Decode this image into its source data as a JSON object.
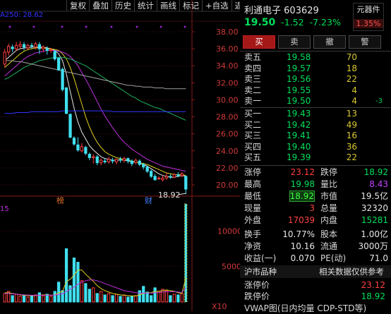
{
  "toolbar": [
    "复权",
    "叠加",
    "历史",
    "统计",
    "画线",
    "标记",
    "+自选",
    "返回"
  ],
  "ma_legend": "A250: 28.62",
  "price_axis": [
    "38.00",
    "36.00",
    "34.00",
    "32.00",
    "30.00",
    "28.00",
    "26.00",
    "24.00",
    "22.00",
    "20.00"
  ],
  "volume_axis": [
    "10000",
    "5000",
    "X10"
  ],
  "chart_marks": {
    "bang": "榜",
    "cai": "财",
    "low_label": "18.92",
    "vol_prefix": "15"
  },
  "stock": {
    "name": "利通电子",
    "code": "603629",
    "price": "19.50",
    "change": "-1.52",
    "change_pct": "-7.23%"
  },
  "component": {
    "label": "元器件",
    "pct": "1.35%"
  },
  "buttons": {
    "buy": "买",
    "sell": "卖",
    "cancel": "撤",
    "alert": "警"
  },
  "asks": [
    {
      "label": "卖五",
      "price": "19.58",
      "vol": "70",
      "ext": ""
    },
    {
      "label": "卖四",
      "price": "19.57",
      "vol": "18",
      "ext": ""
    },
    {
      "label": "卖三",
      "price": "19.56",
      "vol": "22",
      "ext": ""
    },
    {
      "label": "卖二",
      "price": "19.55",
      "vol": "4",
      "ext": ""
    },
    {
      "label": "卖一",
      "price": "19.50",
      "vol": "4",
      "ext": "-3"
    }
  ],
  "bids": [
    {
      "label": "买一",
      "price": "19.43",
      "vol": "13"
    },
    {
      "label": "买二",
      "price": "19.42",
      "vol": "49"
    },
    {
      "label": "买三",
      "price": "19.41",
      "vol": "16"
    },
    {
      "label": "买四",
      "price": "19.40",
      "vol": "36"
    },
    {
      "label": "买五",
      "price": "19.39",
      "vol": "22"
    }
  ],
  "stats": [
    {
      "l1": "涨停",
      "v1": "23.12",
      "l2": "跌停",
      "v2": "18.92"
    },
    {
      "l1": "最高",
      "v1": "19.98",
      "l2": "量比",
      "v2": "8.43"
    },
    {
      "l1": "最低",
      "v1": "18.92",
      "l2": "市值",
      "v2": "19.5亿"
    },
    {
      "l1": "现量",
      "v1": "3",
      "l2": "总量",
      "v2": "32320"
    },
    {
      "l1": "外盘",
      "v1": "17039",
      "l2": "内盘",
      "v2": "15281"
    },
    {
      "l1": "换手",
      "v1": "10.77%",
      "l2": "股本",
      "v2": "1.00亿"
    },
    {
      "l1": "净资",
      "v1": "10.16",
      "l2": "流通",
      "v2": "3000万"
    },
    {
      "l1": "收益(一)",
      "v1": "0.070",
      "l2": "PE(动)",
      "v2": "71.0"
    }
  ],
  "exchange": {
    "left": "沪市品种",
    "right": "相关数据仅供参考"
  },
  "limits": [
    {
      "label": "涨停价",
      "value": "23.12"
    },
    {
      "label": "跌停价",
      "value": "18.92"
    }
  ],
  "vwap": "VWAP图(日内均量 CDP-STD等)",
  "colors": {
    "up": "#ff4040",
    "down": "#00e05a",
    "cyan": "#40e0f0"
  },
  "chart_data": {
    "type": "candlestick",
    "ylim": [
      19.0,
      38.6
    ],
    "candles": [
      {
        "o": 34.2,
        "c": 35.6,
        "h": 36.0,
        "l": 33.8
      },
      {
        "o": 35.6,
        "c": 36.3,
        "h": 36.6,
        "l": 35.2
      },
      {
        "o": 36.2,
        "c": 36.0,
        "h": 36.5,
        "l": 35.6
      },
      {
        "o": 36.0,
        "c": 36.4,
        "h": 36.8,
        "l": 35.7
      },
      {
        "o": 36.3,
        "c": 36.5,
        "h": 36.9,
        "l": 36.0
      },
      {
        "o": 36.5,
        "c": 36.2,
        "h": 36.8,
        "l": 35.8
      },
      {
        "o": 36.1,
        "c": 36.4,
        "h": 36.6,
        "l": 35.9
      },
      {
        "o": 36.4,
        "c": 36.3,
        "h": 36.7,
        "l": 36.0
      },
      {
        "o": 36.2,
        "c": 36.6,
        "h": 36.8,
        "l": 35.9
      },
      {
        "o": 36.5,
        "c": 36.0,
        "h": 36.8,
        "l": 35.4
      },
      {
        "o": 36.0,
        "c": 36.2,
        "h": 36.4,
        "l": 35.6
      },
      {
        "o": 36.0,
        "c": 35.8,
        "h": 36.3,
        "l": 35.3
      },
      {
        "o": 35.8,
        "c": 35.9,
        "h": 36.1,
        "l": 35.5
      },
      {
        "o": 35.7,
        "c": 34.8,
        "h": 35.9,
        "l": 34.6
      },
      {
        "o": 34.9,
        "c": 33.5,
        "h": 35.0,
        "l": 33.4
      },
      {
        "o": 33.6,
        "c": 31.2,
        "h": 33.8,
        "l": 31.0
      },
      {
        "o": 31.4,
        "c": 28.4,
        "h": 31.5,
        "l": 28.3
      },
      {
        "o": 28.3,
        "c": 25.6,
        "h": 28.4,
        "l": 25.5
      },
      {
        "o": 25.5,
        "c": 24.8,
        "h": 25.7,
        "l": 24.6
      },
      {
        "o": 24.7,
        "c": 24.1,
        "h": 25.6,
        "l": 23.9
      },
      {
        "o": 24.0,
        "c": 24.5,
        "h": 24.9,
        "l": 23.8
      },
      {
        "o": 24.4,
        "c": 23.7,
        "h": 24.6,
        "l": 23.5
      },
      {
        "o": 23.6,
        "c": 23.2,
        "h": 23.8,
        "l": 22.9
      },
      {
        "o": 23.2,
        "c": 23.3,
        "h": 23.6,
        "l": 22.5
      },
      {
        "o": 23.3,
        "c": 22.6,
        "h": 23.5,
        "l": 22.3
      },
      {
        "o": 22.6,
        "c": 22.9,
        "h": 23.1,
        "l": 22.3
      },
      {
        "o": 22.8,
        "c": 22.7,
        "h": 23.1,
        "l": 22.5
      },
      {
        "o": 22.7,
        "c": 23.0,
        "h": 23.3,
        "l": 22.5
      },
      {
        "o": 22.9,
        "c": 22.8,
        "h": 23.2,
        "l": 22.5
      },
      {
        "o": 22.7,
        "c": 23.0,
        "h": 23.1,
        "l": 22.4
      },
      {
        "o": 23.0,
        "c": 22.9,
        "h": 23.3,
        "l": 22.6
      },
      {
        "o": 22.9,
        "c": 23.1,
        "h": 23.3,
        "l": 22.6
      },
      {
        "o": 23.1,
        "c": 22.8,
        "h": 23.2,
        "l": 22.5
      },
      {
        "o": 22.8,
        "c": 22.5,
        "h": 23.0,
        "l": 22.2
      },
      {
        "o": 22.6,
        "c": 22.9,
        "h": 23.1,
        "l": 22.4
      },
      {
        "o": 22.8,
        "c": 22.4,
        "h": 23.0,
        "l": 22.2
      },
      {
        "o": 22.4,
        "c": 22.1,
        "h": 22.6,
        "l": 21.8
      },
      {
        "o": 22.1,
        "c": 21.6,
        "h": 22.3,
        "l": 21.4
      },
      {
        "o": 21.6,
        "c": 21.0,
        "h": 21.8,
        "l": 20.8
      },
      {
        "o": 21.0,
        "c": 20.6,
        "h": 21.3,
        "l": 20.5
      },
      {
        "o": 20.7,
        "c": 20.8,
        "h": 21.0,
        "l": 20.6
      },
      {
        "o": 20.6,
        "c": 20.8,
        "h": 21.1,
        "l": 20.4
      },
      {
        "o": 20.8,
        "c": 21.0,
        "h": 21.4,
        "l": 20.6
      },
      {
        "o": 21.0,
        "c": 20.9,
        "h": 21.3,
        "l": 20.7
      },
      {
        "o": 20.9,
        "c": 21.2,
        "h": 21.4,
        "l": 20.8
      },
      {
        "o": 21.2,
        "c": 21.1,
        "h": 21.5,
        "l": 20.9
      },
      {
        "o": 21.1,
        "c": 21.3,
        "h": 21.5,
        "l": 20.9
      },
      {
        "o": 21.0,
        "c": 19.5,
        "h": 21.1,
        "l": 18.9
      }
    ],
    "ma_lines": [
      {
        "color": "#e8e8e8",
        "values": [
          34.6,
          35.0,
          35.4,
          35.8,
          36.0,
          36.1,
          36.1,
          36.2,
          36.2,
          36.2,
          36.2,
          36.1,
          36.0,
          35.8,
          35.4,
          34.6,
          33.0,
          31.0,
          29.0,
          27.4,
          26.2,
          25.4,
          24.6,
          24.1,
          23.7,
          23.3,
          23.1,
          23.0,
          22.9,
          22.9,
          22.9,
          22.9,
          22.8,
          22.7,
          22.7,
          22.6,
          22.4,
          22.2,
          21.9,
          21.6,
          21.3,
          21.1,
          21.0,
          20.9,
          20.9,
          21.0,
          21.1,
          21.0
        ]
      },
      {
        "color": "#e0d020",
        "values": [
          33.8,
          34.2,
          34.6,
          35.0,
          35.4,
          35.7,
          35.9,
          36.0,
          36.1,
          36.1,
          36.1,
          36.0,
          36.0,
          35.9,
          35.8,
          35.4,
          34.8,
          33.8,
          32.5,
          31.0,
          29.5,
          28.0,
          26.8,
          25.8,
          25.0,
          24.4,
          23.9,
          23.6,
          23.4,
          23.2,
          23.1,
          23.0,
          22.9,
          22.8,
          22.7,
          22.6,
          22.5,
          22.4,
          22.2,
          22.0,
          21.8,
          21.6,
          21.4,
          21.3,
          21.2,
          21.2,
          21.2,
          21.1
        ]
      },
      {
        "color": "#c030e0",
        "values": [
          32.8,
          33.2,
          33.6,
          34.0,
          34.4,
          34.8,
          35.1,
          35.3,
          35.5,
          35.6,
          35.7,
          35.8,
          35.8,
          35.8,
          35.7,
          35.6,
          35.4,
          35.1,
          34.6,
          34.0,
          33.2,
          32.4,
          31.6,
          30.7,
          29.8,
          28.9,
          28.1,
          27.4,
          26.7,
          26.1,
          25.5,
          25.0,
          24.6,
          24.2,
          23.9,
          23.6,
          23.3,
          23.0,
          22.8,
          22.6,
          22.4,
          22.2,
          22.1,
          22.0,
          21.9,
          21.8,
          21.7,
          21.6
        ]
      },
      {
        "color": "#20b060",
        "values": [
          32.4,
          32.6,
          32.9,
          33.2,
          33.5,
          33.8,
          34.0,
          34.2,
          34.4,
          34.6,
          34.7,
          34.8,
          34.9,
          35.0,
          35.0,
          35.0,
          34.9,
          34.8,
          34.6,
          34.4,
          34.2,
          34.0,
          33.7,
          33.4,
          33.1,
          32.8,
          32.5,
          32.2,
          31.9,
          31.6,
          31.3,
          31.0,
          30.7,
          30.4,
          30.2,
          29.9,
          29.7,
          29.5,
          29.3,
          29.1,
          29.0,
          28.8,
          28.6,
          28.4,
          28.2,
          28.0,
          27.8,
          27.6
        ]
      },
      {
        "color": "#a0a0a0",
        "values": [
          34.6,
          34.6,
          34.6,
          34.5,
          34.5,
          34.4,
          34.3,
          34.2,
          34.1,
          34.0,
          33.9,
          33.8,
          33.7,
          33.6,
          33.5,
          33.4,
          33.3,
          33.2,
          33.1,
          33.0,
          32.9,
          32.8,
          32.7,
          32.6,
          32.5,
          32.4,
          32.3,
          32.2,
          32.1,
          32.0,
          31.9,
          31.8,
          31.7,
          31.7,
          31.6,
          31.6,
          31.5,
          31.5,
          31.5,
          31.4,
          31.4,
          31.4,
          31.3,
          31.3,
          31.3,
          31.3,
          31.3,
          31.3
        ]
      },
      {
        "color": "#3232ff",
        "values": [
          28.4,
          28.4,
          28.4,
          28.5,
          28.5,
          28.5,
          28.5,
          28.6,
          28.6,
          28.6,
          28.6,
          28.6,
          28.6,
          28.6,
          28.6,
          28.7,
          28.7,
          28.7,
          28.7,
          28.7,
          28.7,
          28.7,
          28.7,
          28.7,
          28.7,
          28.7,
          28.7,
          28.7,
          28.6,
          28.6,
          28.6,
          28.6,
          28.6,
          28.6,
          28.6,
          28.6,
          28.6,
          28.6,
          28.6,
          28.6,
          28.6,
          28.6,
          28.6,
          28.6,
          28.6,
          28.6,
          28.6,
          28.6
        ]
      }
    ],
    "volume_ylim": [
      0,
      14000
    ],
    "volumes": [
      1200,
      1500,
      900,
      1100,
      800,
      1000,
      700,
      900,
      1000,
      1300,
      900,
      1100,
      800,
      1500,
      2800,
      1600,
      7500,
      2300,
      6200,
      5600,
      3000,
      2600,
      1800,
      2000,
      1200,
      1500,
      1000,
      1200,
      900,
      1100,
      800,
      1000,
      700,
      800,
      900,
      1600,
      2200,
      1400,
      900,
      2000,
      1500,
      1800,
      1600,
      900,
      1100,
      1000,
      1200,
      13800
    ],
    "vol_lines": [
      {
        "color": "#e0d020",
        "values": [
          1300,
          1300,
          1200,
          1100,
          1000,
          950,
          900,
          900,
          900,
          950,
          1000,
          1000,
          950,
          1000,
          1300,
          1500,
          2900,
          3200,
          3800,
          4500,
          4500,
          3900,
          3400,
          2900,
          2300,
          1900,
          1600,
          1400,
          1200,
          1100,
          1000,
          950,
          900,
          850,
          850,
          1000,
          1200,
          1300,
          1300,
          1500,
          1500,
          1600,
          1700,
          1600,
          1500,
          1300,
          1200,
          3400
        ]
      },
      {
        "color": "#c030e0",
        "values": [
          1200,
          1200,
          1150,
          1100,
          1050,
          1000,
          980,
          950,
          930,
          930,
          950,
          960,
          960,
          980,
          1050,
          1150,
          1500,
          1800,
          2100,
          2500,
          2800,
          3000,
          3100,
          3100,
          3000,
          2800,
          2600,
          2400,
          2200,
          2000,
          1800,
          1600,
          1500,
          1400,
          1300,
          1250,
          1250,
          1250,
          1250,
          1300,
          1350,
          1400,
          1450,
          1450,
          1450,
          1400,
          1350,
          2000
        ]
      }
    ]
  }
}
